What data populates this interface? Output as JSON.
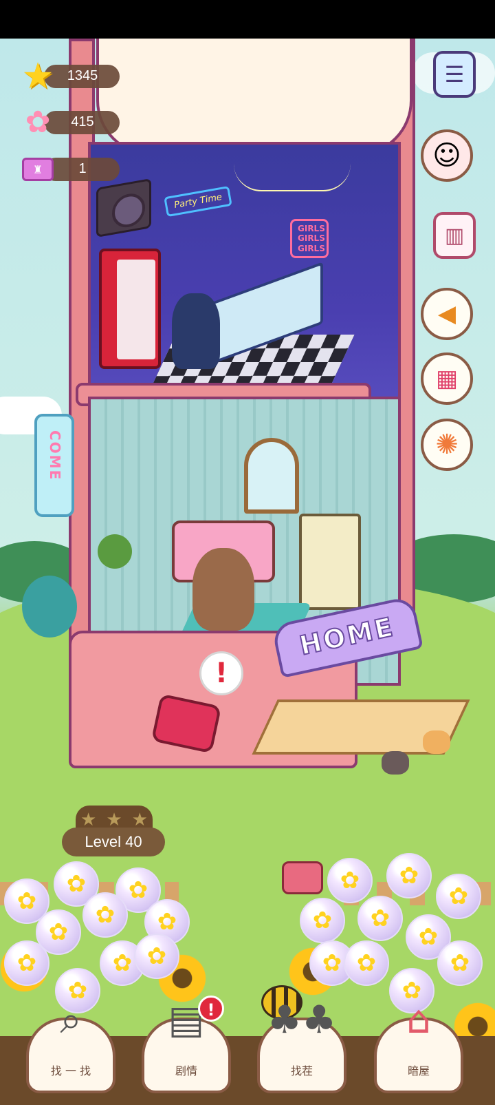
{
  "resources": {
    "stars": "1345",
    "flowers": "415",
    "tickets": "1"
  },
  "signs": {
    "home": "HOME",
    "come": "COME",
    "neon_girls": "GIRLS GIRLS GIRLS",
    "neon_party": "Party Time"
  },
  "alert": {
    "mark": "!"
  },
  "level": {
    "label": "Level 40",
    "stars_filled": 0,
    "stars_total": 3
  },
  "bottom_nav": {
    "items": [
      {
        "label": "找 一 找",
        "icon": "magnifier-icon"
      },
      {
        "label": "剧情",
        "icon": "storybook-icon",
        "badge": "!"
      },
      {
        "label": "找茬",
        "icon": "twin-plants-icon"
      },
      {
        "label": "暗屋",
        "icon": "house-icon"
      }
    ]
  },
  "right_buttons": [
    "task-list-icon",
    "avatar-girl-icon",
    "wardrobe-icon",
    "megaphone-icon",
    "calendar-icon",
    "prize-wheel-icon"
  ],
  "colors": {
    "accent_brown": "#8a5b45",
    "tower_pink": "#e98a8f",
    "star_yellow": "#ffd21f",
    "alert_red": "#e0283c"
  }
}
